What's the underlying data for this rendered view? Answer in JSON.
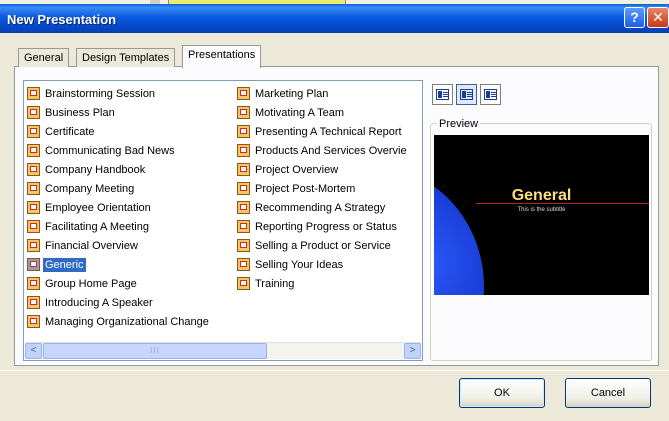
{
  "window": {
    "title": "New Presentation",
    "help_label": "?",
    "close_label": "✕"
  },
  "tabs": [
    {
      "label": "General"
    },
    {
      "label": "Design Templates"
    },
    {
      "label": "Presentations",
      "active": true
    }
  ],
  "list": {
    "column1": [
      {
        "label": "Brainstorming Session",
        "icon": "presentation-file-icon"
      },
      {
        "label": "Business Plan",
        "icon": "presentation-file-icon"
      },
      {
        "label": "Certificate",
        "icon": "presentation-file-icon"
      },
      {
        "label": "Communicating Bad News",
        "icon": "presentation-file-icon"
      },
      {
        "label": "Company Handbook",
        "icon": "presentation-file-icon"
      },
      {
        "label": "Company Meeting",
        "icon": "presentation-file-icon"
      },
      {
        "label": "Employee Orientation",
        "icon": "presentation-file-icon"
      },
      {
        "label": "Facilitating A Meeting",
        "icon": "presentation-file-icon"
      },
      {
        "label": "Financial Overview",
        "icon": "presentation-file-icon"
      },
      {
        "label": "Generic",
        "icon": "presentation-file-icon",
        "selected": true
      },
      {
        "label": "Group Home Page",
        "icon": "presentation-file-icon"
      },
      {
        "label": "Introducing A Speaker",
        "icon": "presentation-file-icon"
      },
      {
        "label": "Managing Organizational Change",
        "icon": "presentation-file-icon"
      }
    ],
    "column2": [
      {
        "label": "Marketing Plan",
        "icon": "presentation-file-icon"
      },
      {
        "label": "Motivating A Team",
        "icon": "presentation-file-icon"
      },
      {
        "label": "Presenting A Technical Report",
        "icon": "presentation-file-icon"
      },
      {
        "label": "Products And Services Overvie",
        "icon": "presentation-file-icon"
      },
      {
        "label": "Project Overview",
        "icon": "presentation-file-icon"
      },
      {
        "label": "Project Post-Mortem",
        "icon": "presentation-file-icon"
      },
      {
        "label": "Recommending A Strategy",
        "icon": "presentation-file-icon"
      },
      {
        "label": "Reporting Progress or Status",
        "icon": "presentation-file-icon"
      },
      {
        "label": "Selling a Product or Service",
        "icon": "presentation-file-icon"
      },
      {
        "label": "Selling Your Ideas",
        "icon": "presentation-file-icon"
      },
      {
        "label": "Training",
        "icon": "presentation-file-icon"
      }
    ],
    "scrollbar": {
      "left_arrow": "<",
      "right_arrow": ">",
      "grip": "III"
    }
  },
  "view_buttons": [
    {
      "name": "large-icons-view-icon"
    },
    {
      "name": "list-view-icon",
      "pressed": true
    },
    {
      "name": "details-view-icon"
    }
  ],
  "preview": {
    "label": "Preview",
    "slide_title": "General",
    "slide_subtitle": "This is the subtitle"
  },
  "buttons": {
    "ok": "OK",
    "cancel": "Cancel"
  },
  "colors": {
    "titlebar": "#0b5ae0",
    "selection": "#316ac5",
    "slide_title": "#ffde7c"
  }
}
